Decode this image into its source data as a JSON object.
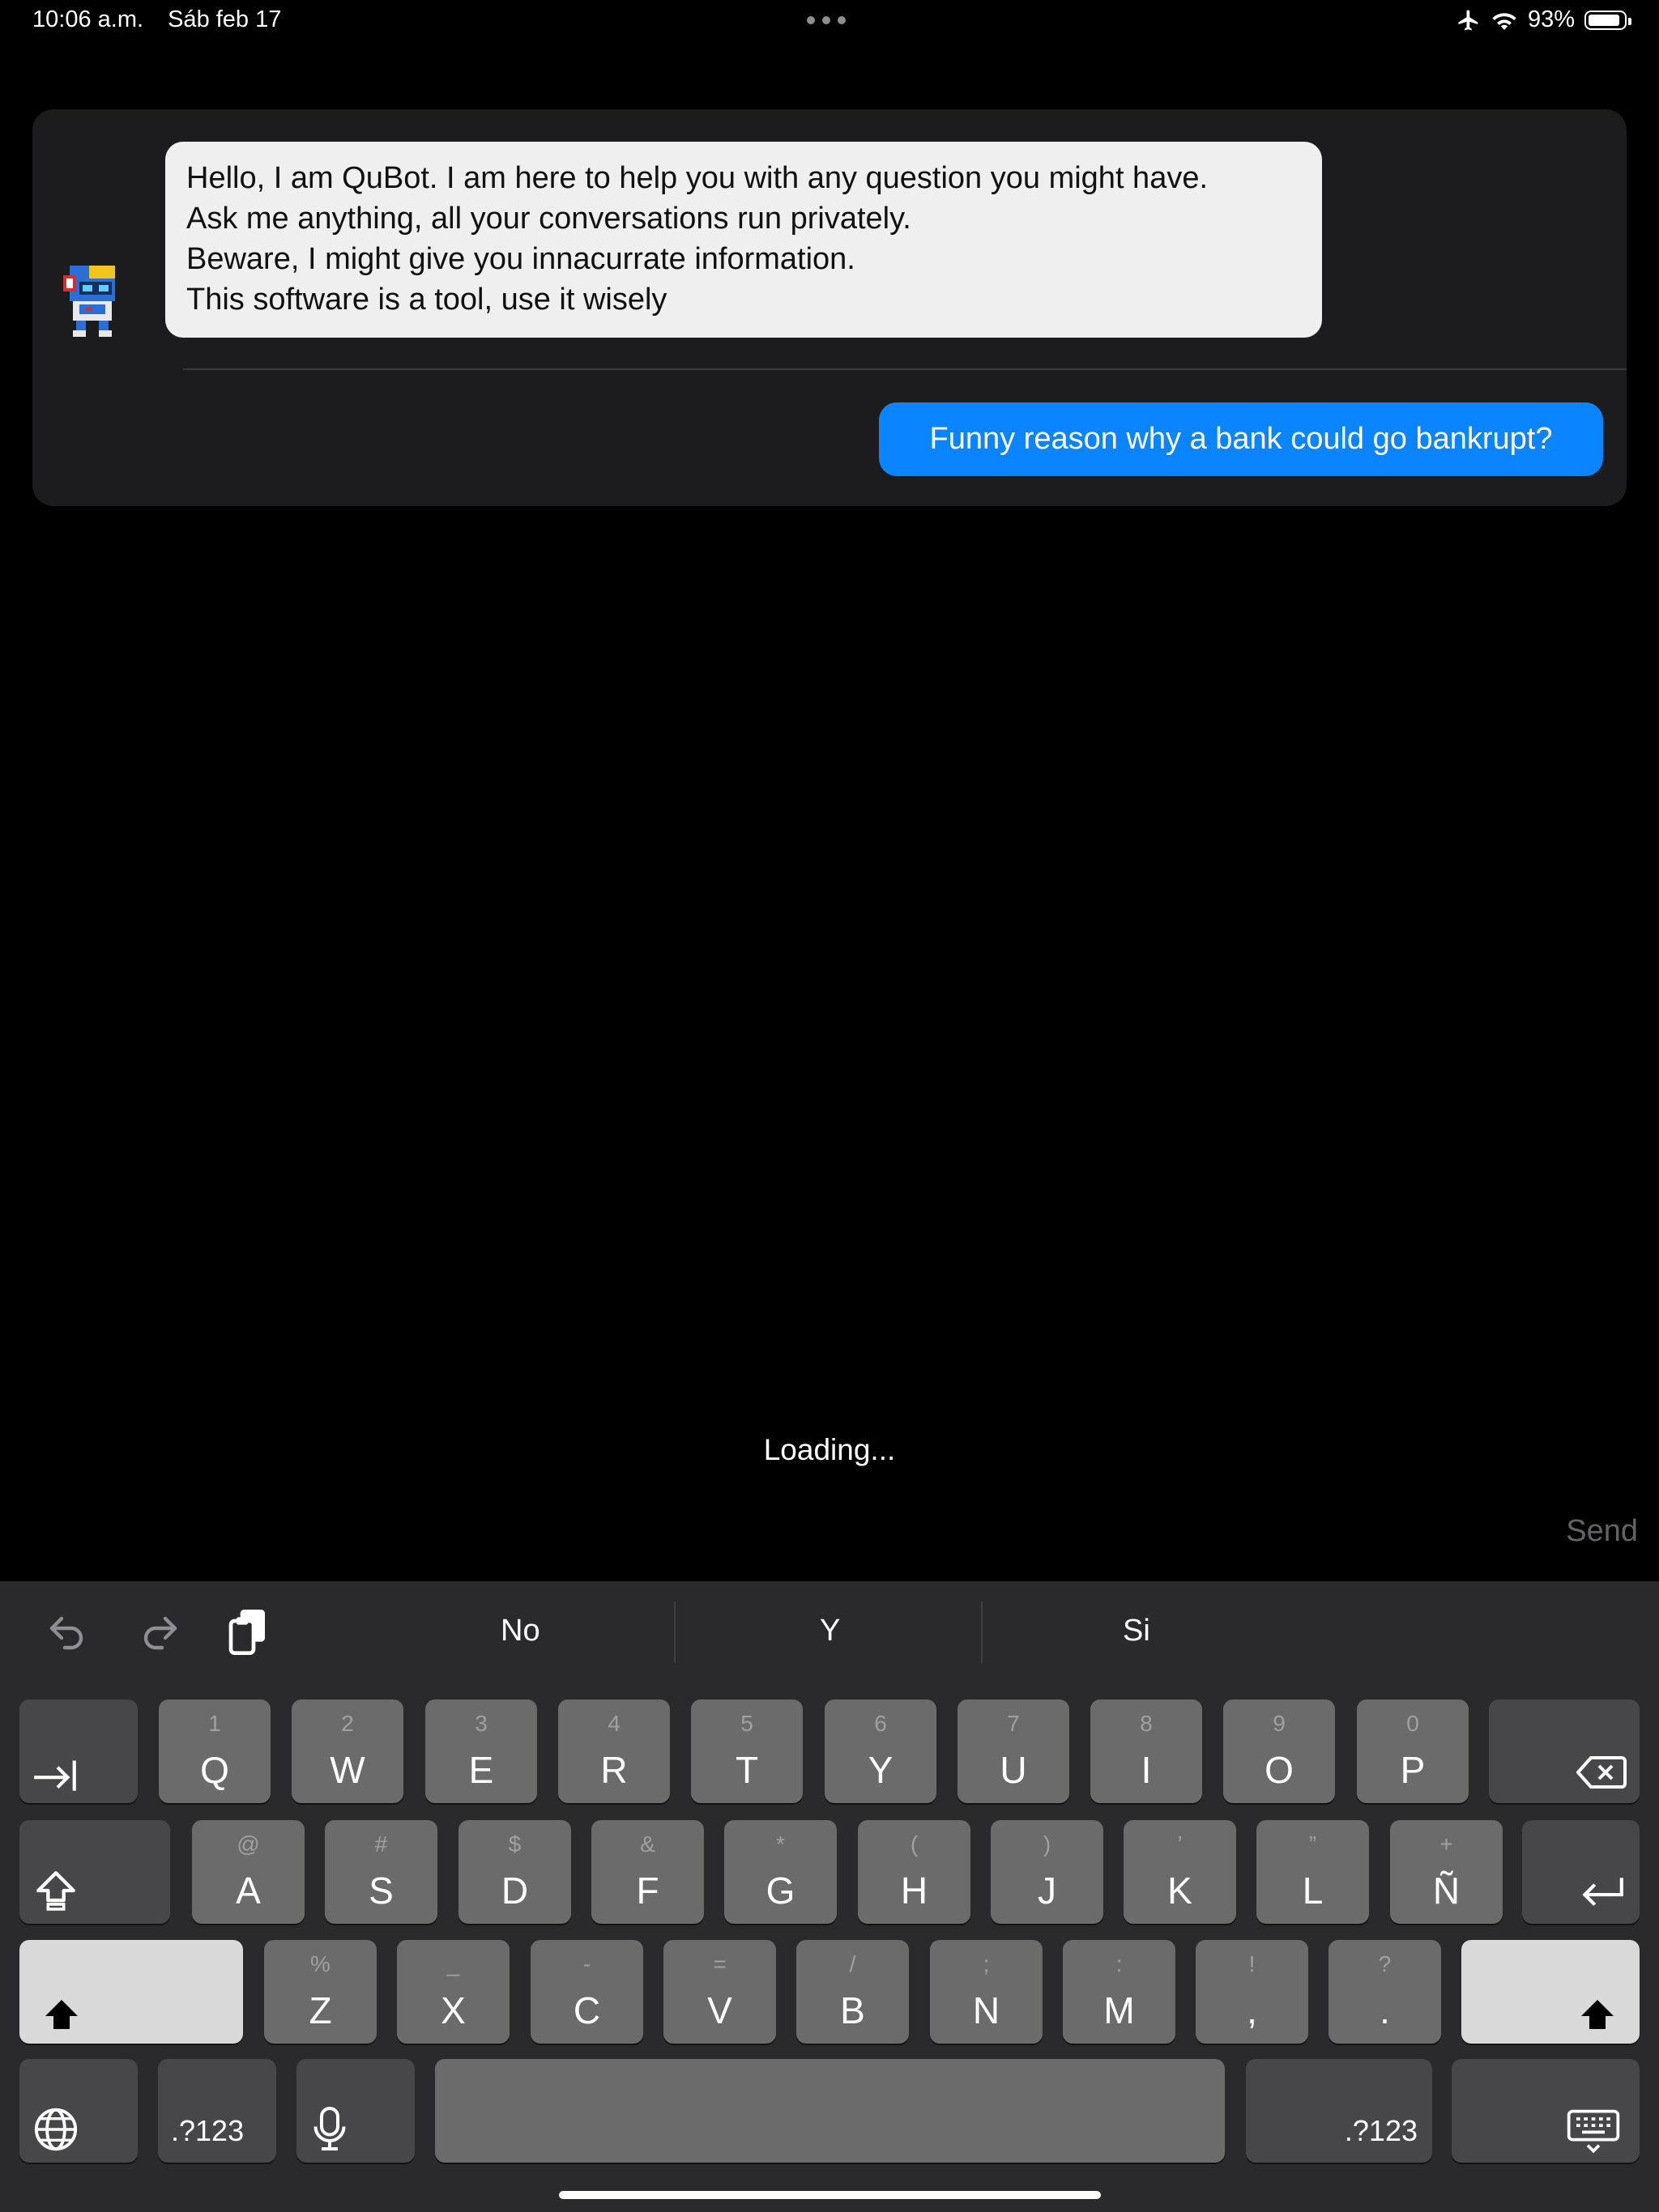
{
  "status_bar": {
    "time": "10:06 a.m.",
    "date": "Sáb feb 17",
    "battery_text": "93%",
    "battery_level": 0.93,
    "icons": [
      "airplane-icon",
      "wifi-icon",
      "battery-icon"
    ]
  },
  "chat": {
    "bot_name": "QuBot",
    "bot_message_lines": [
      "Hello, I am QuBot. I am here to help you with any question you might have.",
      "Ask me anything, all your conversations run privately.",
      "Beware, I might give you innacurrate information.",
      "This software is a tool, use it wisely"
    ],
    "user_message": "Funny reason why a bank could go bankrupt?",
    "colors": {
      "user_bubble": "#0a84ff",
      "bot_bubble": "#efefef",
      "card": "#1c1c1e"
    }
  },
  "loading_text": "Loading...",
  "send_label": "Send",
  "keyboard": {
    "suggestions": [
      "No",
      "Y",
      "Si"
    ],
    "row1": [
      {
        "main": "Q",
        "sub": "1"
      },
      {
        "main": "W",
        "sub": "2"
      },
      {
        "main": "E",
        "sub": "3"
      },
      {
        "main": "R",
        "sub": "4"
      },
      {
        "main": "T",
        "sub": "5"
      },
      {
        "main": "Y",
        "sub": "6"
      },
      {
        "main": "U",
        "sub": "7"
      },
      {
        "main": "I",
        "sub": "8"
      },
      {
        "main": "O",
        "sub": "9"
      },
      {
        "main": "P",
        "sub": "0"
      }
    ],
    "row2": [
      {
        "main": "A",
        "sub": "@"
      },
      {
        "main": "S",
        "sub": "#"
      },
      {
        "main": "D",
        "sub": "$"
      },
      {
        "main": "F",
        "sub": "&"
      },
      {
        "main": "G",
        "sub": "*"
      },
      {
        "main": "H",
        "sub": "("
      },
      {
        "main": "J",
        "sub": ")"
      },
      {
        "main": "K",
        "sub": "’"
      },
      {
        "main": "L",
        "sub": "”"
      },
      {
        "main": "Ñ",
        "sub": "+"
      }
    ],
    "row3": [
      {
        "main": "Z",
        "sub": "%"
      },
      {
        "main": "X",
        "sub": "_"
      },
      {
        "main": "C",
        "sub": "-"
      },
      {
        "main": "V",
        "sub": "="
      },
      {
        "main": "B",
        "sub": "/"
      },
      {
        "main": "N",
        "sub": ";"
      },
      {
        "main": "M",
        "sub": ":"
      },
      {
        "main": ",",
        "sub": "!"
      },
      {
        "main": ".",
        "sub": "?"
      }
    ],
    "numbers_label": ".?123"
  }
}
